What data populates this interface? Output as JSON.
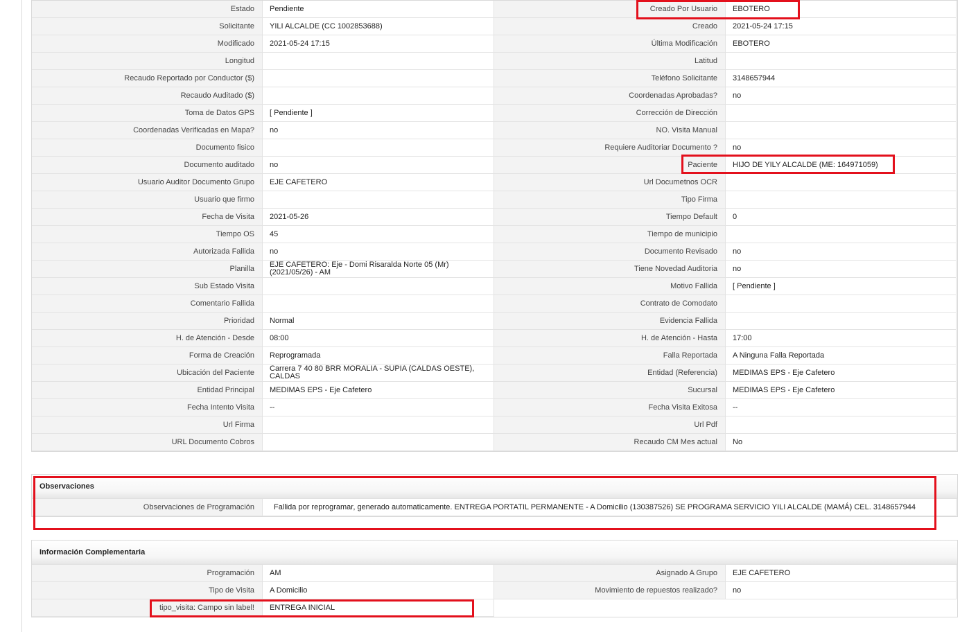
{
  "main_rows": [
    [
      "Estado",
      "Pendiente",
      "Creado Por Usuario",
      "EBOTERO"
    ],
    [
      "Solicitante",
      "YILI ALCALDE (CC 1002853688)",
      "Creado",
      "2021-05-24 17:15"
    ],
    [
      "Modificado",
      "2021-05-24 17:15",
      "Última Modificación",
      " EBOTERO"
    ],
    [
      "Longitud",
      "",
      "Latitud",
      ""
    ],
    [
      "Recaudo Reportado por Conductor ($)",
      "",
      "Teléfono Solicitante",
      "3148657944"
    ],
    [
      "Recaudo Auditado ($)",
      "",
      "Coordenadas Aprobadas?",
      " no"
    ],
    [
      "Toma de Datos GPS",
      "[ Pendiente ]",
      "Corrección de Dirección",
      ""
    ],
    [
      "Coordenadas Verificadas en Mapa?",
      " no",
      "NO. Visita Manual",
      ""
    ],
    [
      "Documento fisico",
      "",
      "Requiere Auditoriar Documento ?",
      " no"
    ],
    [
      "Documento auditado",
      " no",
      "Paciente",
      "HIJO DE YILY ALCALDE (ME: 164971059)"
    ],
    [
      "Usuario Auditor Documento Grupo",
      "EJE CAFETERO",
      "Url Documetnos OCR",
      ""
    ],
    [
      "Usuario que firmo",
      "",
      "Tipo Firma",
      ""
    ],
    [
      "Fecha de Visita",
      " 2021-05-26",
      "Tiempo Default",
      "0"
    ],
    [
      "Tiempo OS",
      "45",
      "Tiempo de municipio",
      ""
    ],
    [
      "Autorizada Fallida",
      " no",
      "Documento Revisado",
      " no"
    ],
    [
      "Planilla",
      "EJE CAFETERO: Eje - Domi Risaralda Norte 05 (Mr) (2021/05/26) - AM",
      "Tiene Novedad Auditoria",
      " no"
    ],
    [
      "Sub Estado Visita",
      "",
      "Motivo Fallida",
      "[ Pendiente ]"
    ],
    [
      "Comentario Fallida",
      "",
      "Contrato de Comodato",
      ""
    ],
    [
      "Prioridad",
      "Normal",
      "Evidencia Fallida",
      ""
    ],
    [
      "H. de Atención - Desde",
      "08:00",
      "H. de Atención - Hasta",
      "17:00"
    ],
    [
      "Forma de Creación",
      "Reprogramada",
      "Falla Reportada",
      "A Ninguna Falla Reportada"
    ],
    [
      "Ubicación del Paciente",
      "Carrera 7 40 80 BRR MORALIA - SUPIA (CALDAS OESTE), CALDAS",
      "Entidad (Referencia)",
      "MEDIMAS EPS - Eje Cafetero"
    ],
    [
      "Entidad Principal",
      "MEDIMAS EPS - Eje Cafetero",
      "Sucursal",
      "MEDIMAS EPS - Eje Cafetero"
    ],
    [
      "Fecha Intento Visita",
      " --",
      "Fecha Visita Exitosa",
      " --"
    ],
    [
      "Url Firma",
      "",
      "Url Pdf",
      ""
    ],
    [
      "URL Documento Cobros",
      "",
      "Recaudo CM Mes actual",
      "No"
    ]
  ],
  "observaciones": {
    "title": "Observaciones",
    "label": "Observaciones de Programación",
    "value": "Fallida por reprogramar, generado automaticamente. ENTREGA PORTATIL PERMANENTE - A Domicilio (130387526) SE PROGRAMA SERVICIO YILI ALCALDE (MAMÁ) CEL. 3148657944"
  },
  "complementaria": {
    "title": "Información Complementaria",
    "rows": [
      [
        "Programación",
        "AM",
        "Asignado A Grupo",
        "EJE CAFETERO"
      ],
      [
        "Tipo de Visita",
        "A Domicilio",
        "Movimiento de repuestos realizado?",
        " no"
      ]
    ],
    "last_label": "tipo_visita: Campo sin label!",
    "last_value": "ENTREGA INICIAL"
  },
  "highlight_color": "#e3101c"
}
